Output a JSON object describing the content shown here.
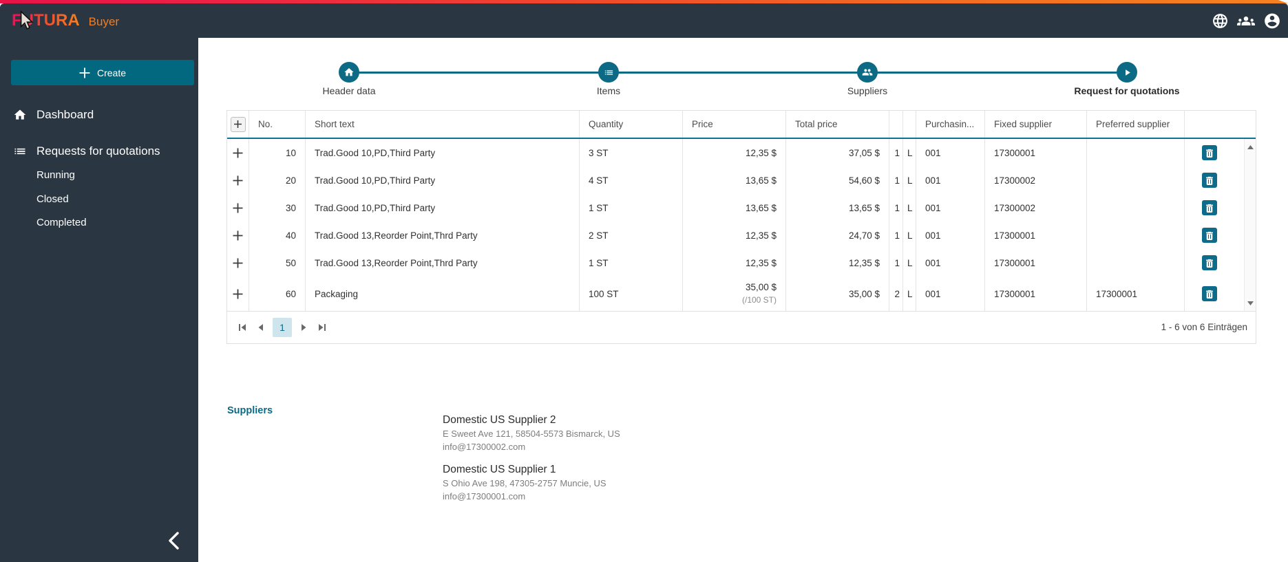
{
  "brand": {
    "logo_f": "F",
    "logo_u": "U",
    "logo_rest": "TURA",
    "product": "Buyer"
  },
  "colors": {
    "accent_teal": "#0c6a84",
    "dark_header": "#2a3642",
    "ribbon_left": "#e81349",
    "ribbon_right": "#f58220"
  },
  "sidebar": {
    "create_label": "Create",
    "items": [
      {
        "label": "Dashboard"
      },
      {
        "label": "Requests for quotations"
      }
    ],
    "subitems": [
      {
        "label": "Running"
      },
      {
        "label": "Closed"
      },
      {
        "label": "Completed"
      }
    ]
  },
  "stepper": {
    "steps": [
      {
        "label": "Header data"
      },
      {
        "label": "Items"
      },
      {
        "label": "Suppliers"
      },
      {
        "label": "Request for quotations"
      }
    ]
  },
  "table": {
    "headers": {
      "no": "No.",
      "short_text": "Short text",
      "quantity": "Quantity",
      "price": "Price",
      "total_price": "Total price",
      "purchasing": "Purchasin...",
      "fixed_supplier": "Fixed supplier",
      "preferred_supplier": "Preferred supplier"
    },
    "rows": [
      {
        "no": "10",
        "short_text": "Trad.Good 10,PD,Third Party",
        "quantity": "3 ST",
        "price": "12,35 $",
        "price_sub": "",
        "total": "37,05 $",
        "col_a": "1",
        "col_b": "L",
        "purchasing": "001",
        "fixed_supplier": "17300001",
        "preferred_supplier": ""
      },
      {
        "no": "20",
        "short_text": "Trad.Good 10,PD,Third Party",
        "quantity": "4 ST",
        "price": "13,65 $",
        "price_sub": "",
        "total": "54,60 $",
        "col_a": "1",
        "col_b": "L",
        "purchasing": "001",
        "fixed_supplier": "17300002",
        "preferred_supplier": ""
      },
      {
        "no": "30",
        "short_text": "Trad.Good 10,PD,Third Party",
        "quantity": "1 ST",
        "price": "13,65 $",
        "price_sub": "",
        "total": "13,65 $",
        "col_a": "1",
        "col_b": "L",
        "purchasing": "001",
        "fixed_supplier": "17300002",
        "preferred_supplier": ""
      },
      {
        "no": "40",
        "short_text": "Trad.Good 13,Reorder Point,Thrd Party",
        "quantity": "2 ST",
        "price": "12,35 $",
        "price_sub": "",
        "total": "24,70 $",
        "col_a": "1",
        "col_b": "L",
        "purchasing": "001",
        "fixed_supplier": "17300001",
        "preferred_supplier": ""
      },
      {
        "no": "50",
        "short_text": "Trad.Good 13,Reorder Point,Thrd Party",
        "quantity": "1 ST",
        "price": "12,35 $",
        "price_sub": "",
        "total": "12,35 $",
        "col_a": "1",
        "col_b": "L",
        "purchasing": "001",
        "fixed_supplier": "17300001",
        "preferred_supplier": ""
      },
      {
        "no": "60",
        "short_text": "Packaging",
        "quantity": "100 ST",
        "price": "35,00 $",
        "price_sub": "(/100 ST)",
        "total": "35,00 $",
        "col_a": "2",
        "col_b": "L",
        "purchasing": "001",
        "fixed_supplier": "17300001",
        "preferred_supplier": "17300001"
      }
    ]
  },
  "pagination": {
    "current_page": "1",
    "info": "1 - 6 von 6 Einträgen"
  },
  "suppliers_section": {
    "heading": "Suppliers",
    "entries": [
      {
        "name": "Domestic US Supplier 2",
        "address": "E Sweet Ave 121, 58504-5573 Bismarck, US",
        "email": "info@17300002.com"
      },
      {
        "name": "Domestic US Supplier 1",
        "address": "S Ohio Ave 198, 47305-2757 Muncie, US",
        "email": "info@17300001.com"
      }
    ]
  }
}
